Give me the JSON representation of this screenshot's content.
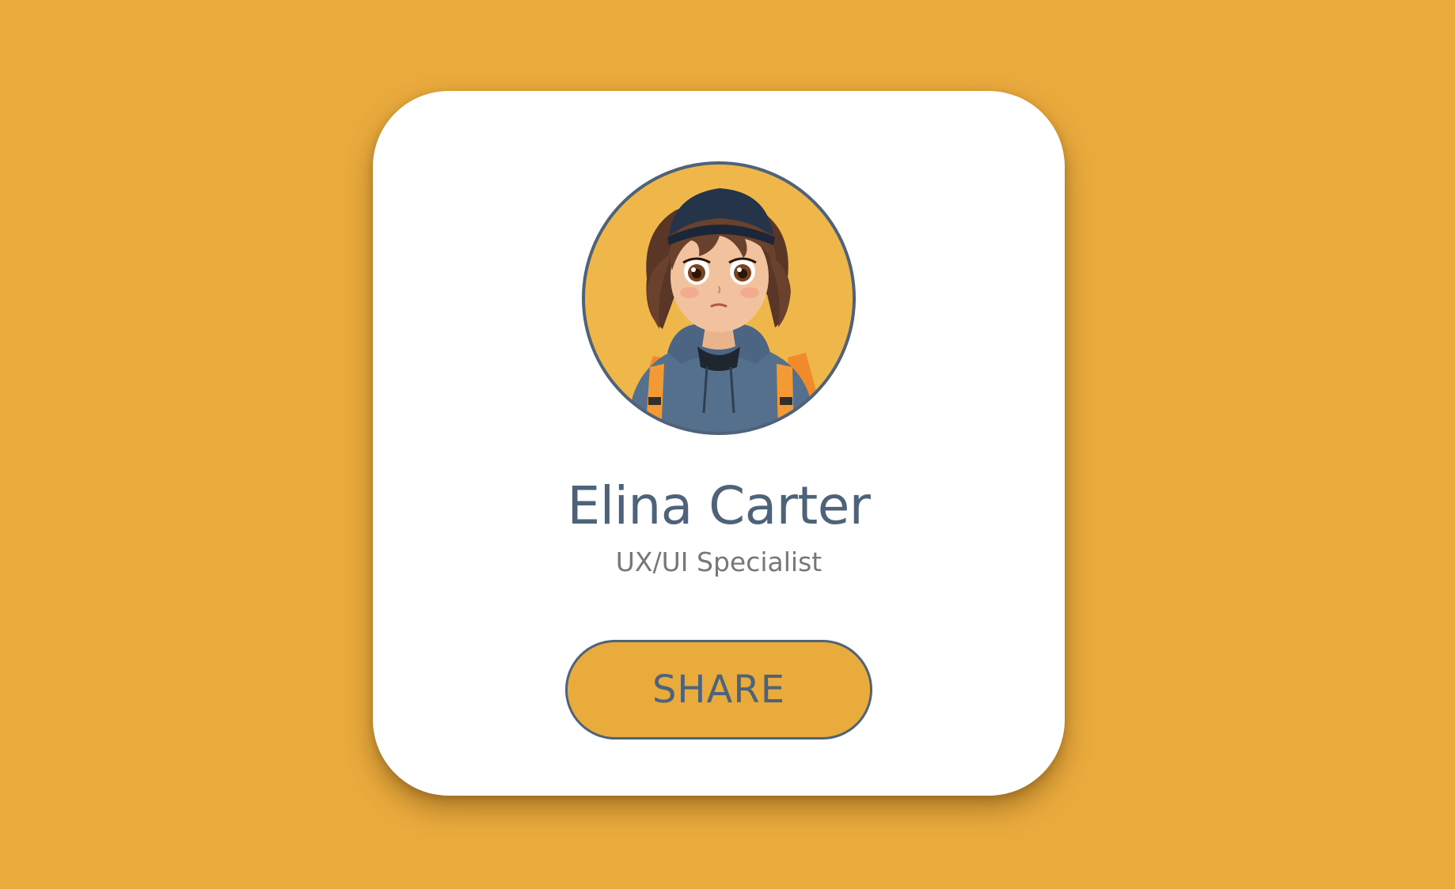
{
  "colors": {
    "background": "#eaab3d",
    "card": "#ffffff",
    "accent_slate": "#4e6379",
    "role_text": "#777777",
    "button_fill": "#eaab3d",
    "avatar_bg": "#efb64a"
  },
  "profile": {
    "name": "Elina Carter",
    "role": "UX/UI Specialist",
    "avatar_icon": "cartoon-girl-avatar"
  },
  "actions": {
    "share_label": "SHARE"
  }
}
